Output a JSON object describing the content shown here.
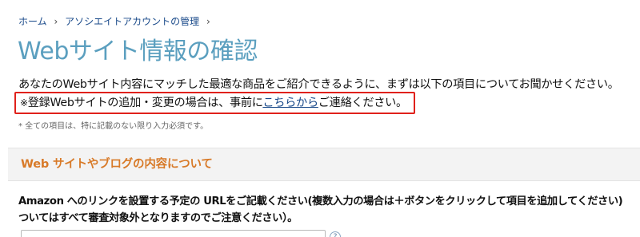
{
  "breadcrumb": {
    "home": "ホーム",
    "separator": "›",
    "account": "アソシエイトアカウントの管理"
  },
  "page": {
    "title": "Webサイト情報の確認"
  },
  "intro": {
    "text": "あなたのWebサイト内容にマッチした最適な商品をご紹介できるように、まずは以下の項目についてお聞かせください。"
  },
  "notice": {
    "mark": "※",
    "before": "登録Webサイトの追加・変更の場合は、事前に",
    "link": "こちらから",
    "after": "ご連絡ください。",
    "highlight_color": "#e0211b"
  },
  "required_note": "* 全ての項目は、特に記載のない限り入力必須です。",
  "section": {
    "title": "Web サイトやブログの内容について",
    "title_color": "#d87a28"
  },
  "question": {
    "line1": "Amazon へのリンクを設置する予定の URLをご記載ください(複数入力の場合は＋ボタンをクリックして項目を追加してください) ",
    "line2": "ついてはすべて審査対象外となりますのでご注意ください）。"
  },
  "url_input": {
    "value": "",
    "placeholder": ""
  },
  "icons": {
    "help": "help-icon"
  },
  "colors": {
    "title": "#5b9fbf",
    "link": "#1a4a8a"
  }
}
